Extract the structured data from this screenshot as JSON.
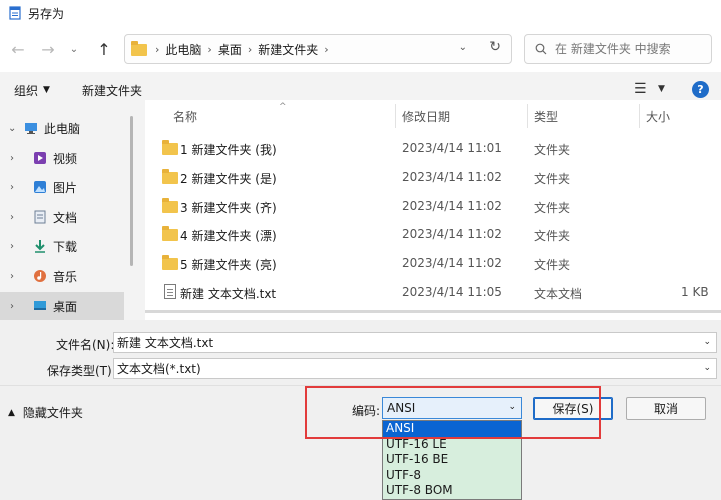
{
  "window": {
    "title": "另存为"
  },
  "nav": {
    "back_icon": "back-arrow-icon",
    "forward_icon": "forward-arrow-icon",
    "recent_icon": "chevron-down-icon",
    "up_icon": "up-arrow-icon",
    "breadcrumb": [
      "此电脑",
      "桌面",
      "新建文件夹"
    ],
    "search_placeholder": "在 新建文件夹 中搜索"
  },
  "toolbar": {
    "organize": "组织",
    "new_folder": "新建文件夹",
    "help": "?"
  },
  "sidebar": {
    "root": "此电脑",
    "items": [
      "视频",
      "图片",
      "文档",
      "下载",
      "音乐",
      "桌面"
    ]
  },
  "filelist": {
    "columns": {
      "name": "名称",
      "date": "修改日期",
      "type": "类型",
      "size": "大小"
    },
    "rows": [
      {
        "name": "1 新建文件夹 (我)",
        "date": "2023/4/14 11:01",
        "type": "文件夹",
        "size": ""
      },
      {
        "name": "2 新建文件夹 (是)",
        "date": "2023/4/14 11:02",
        "type": "文件夹",
        "size": ""
      },
      {
        "name": "3 新建文件夹 (齐)",
        "date": "2023/4/14 11:02",
        "type": "文件夹",
        "size": ""
      },
      {
        "name": "4 新建文件夹 (漂)",
        "date": "2023/4/14 11:02",
        "type": "文件夹",
        "size": ""
      },
      {
        "name": "5 新建文件夹 (亮)",
        "date": "2023/4/14 11:02",
        "type": "文件夹",
        "size": ""
      },
      {
        "name": "新建 文本文档.txt",
        "date": "2023/4/14 11:05",
        "type": "文本文档",
        "size": "1 KB"
      }
    ]
  },
  "form": {
    "filename_label": "文件名(N):",
    "filename_value": "新建 文本文档.txt",
    "filetype_label": "保存类型(T):",
    "filetype_value": "文本文档(*.txt)",
    "hide_folders": "隐藏文件夹",
    "encoding_label": "编码:",
    "encoding_value": "ANSI",
    "save": "保存(S)",
    "cancel": "取消"
  },
  "encoding_options": [
    "ANSI",
    "UTF-16 LE",
    "UTF-16 BE",
    "UTF-8",
    "UTF-8 BOM"
  ],
  "colors": {
    "accent": "#1f6cc8",
    "highlight_box": "#e23b3b",
    "selected_option": "#0a64d2",
    "folder": "#f2c44c"
  }
}
